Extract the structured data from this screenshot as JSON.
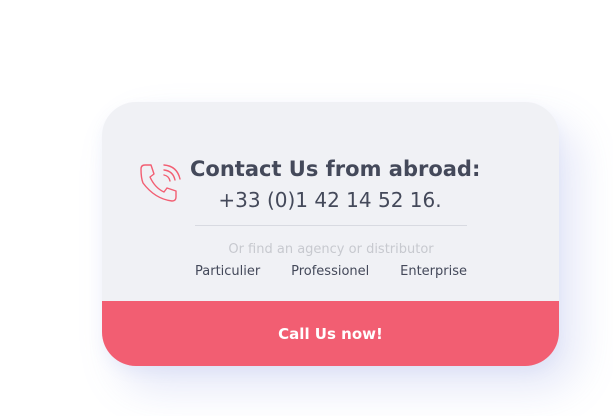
{
  "contact": {
    "title": "Contact Us from abroad:",
    "phone": "+33 (0)1 42 14 52 16.",
    "subtext": "Or find an agency or distributor",
    "links": [
      "Particulier",
      "Professionel",
      "Enterprise"
    ],
    "cta_label": "Call Us now!"
  },
  "icons": {
    "phone": "phone-ringing-icon"
  },
  "colors": {
    "card_background": "#f0f1f5",
    "accent": "#f25e72",
    "text": "#44495a",
    "muted_text": "#c7c9cf"
  }
}
